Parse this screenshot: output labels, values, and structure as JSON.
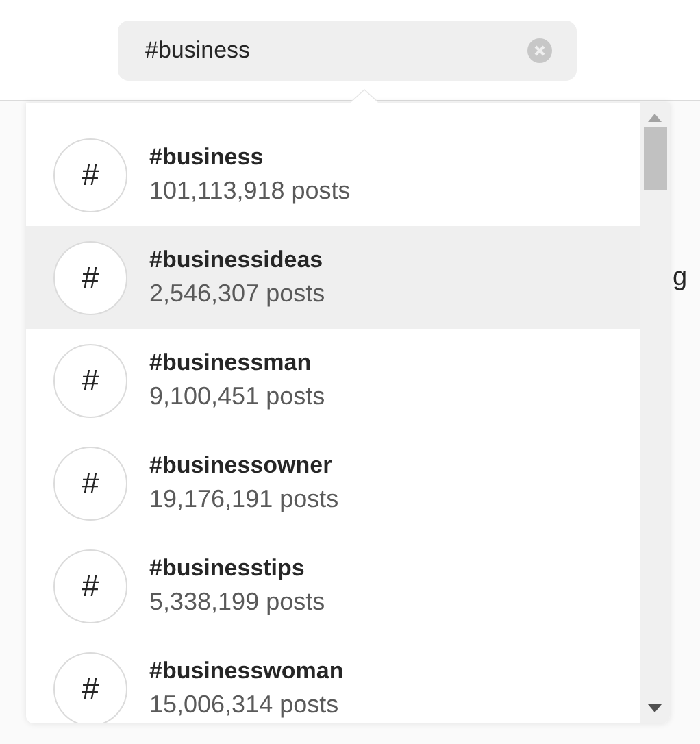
{
  "search": {
    "value": "#business"
  },
  "results": [
    {
      "icon": "#",
      "name": "#business",
      "count": "101,113,918 posts",
      "selected": false
    },
    {
      "icon": "#",
      "name": "#businessideas",
      "count": "2,546,307 posts",
      "selected": true
    },
    {
      "icon": "#",
      "name": "#businessman",
      "count": "9,100,451 posts",
      "selected": false
    },
    {
      "icon": "#",
      "name": "#businessowner",
      "count": "19,176,191 posts",
      "selected": false
    },
    {
      "icon": "#",
      "name": "#businesstips",
      "count": "5,338,199 posts",
      "selected": false
    },
    {
      "icon": "#",
      "name": "#businesswoman",
      "count": "15,006,314 posts",
      "selected": false
    }
  ],
  "background_text": "g"
}
